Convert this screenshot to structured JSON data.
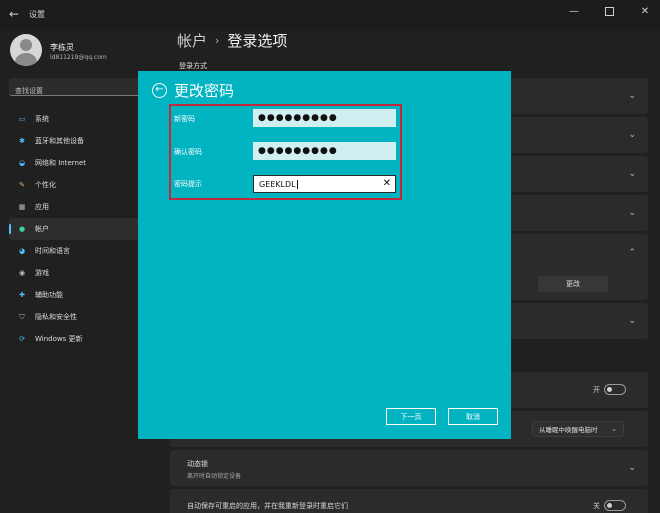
{
  "titlebar": {
    "title": "设置"
  },
  "user": {
    "name": "李栋灵",
    "email": "ld811219@qq.com"
  },
  "search": {
    "placeholder": "查找设置"
  },
  "nav": {
    "items": [
      {
        "label": "系统",
        "icon": "monitor-icon"
      },
      {
        "label": "蓝牙和其他设备",
        "icon": "bluetooth-icon"
      },
      {
        "label": "网络和 Internet",
        "icon": "wifi-icon"
      },
      {
        "label": "个性化",
        "icon": "brush-icon"
      },
      {
        "label": "应用",
        "icon": "apps-icon"
      },
      {
        "label": "帐户",
        "icon": "person-icon"
      },
      {
        "label": "时间和语言",
        "icon": "globe-clock-icon"
      },
      {
        "label": "游戏",
        "icon": "gamepad-icon"
      },
      {
        "label": "辅助功能",
        "icon": "accessibility-icon"
      },
      {
        "label": "隐私和安全性",
        "icon": "shield-icon"
      },
      {
        "label": "Windows 更新",
        "icon": "update-icon"
      }
    ],
    "active_index": 5
  },
  "main": {
    "breadcrumb_parent": "帐户",
    "breadcrumb_current": "登录选项",
    "section_label": "登录方式",
    "change_label": "更改",
    "toggle_label": "开",
    "dropdown_value": "从睡眠中唤醒电脑时",
    "dynamic_lock_title": "动态锁",
    "dynamic_lock_sub": "离开时自动锁定设备",
    "bottom_text": "自动保存可重启的应用，并在我重新登录时重启它们",
    "bottom_toggle_label": "关"
  },
  "dialog": {
    "title": "更改密码",
    "new_password_label": "新密码",
    "new_password_value": "●●●●●●●●●",
    "confirm_password_label": "确认密码",
    "confirm_password_value": "●●●●●●●●●",
    "hint_label": "密码提示",
    "hint_value": "GEEKLDL",
    "next_label": "下一页",
    "cancel_label": "取消"
  },
  "colors": {
    "dialog_bg": "#02b3c2",
    "highlight": "#c2293b",
    "accent": "#4cc2ff"
  }
}
